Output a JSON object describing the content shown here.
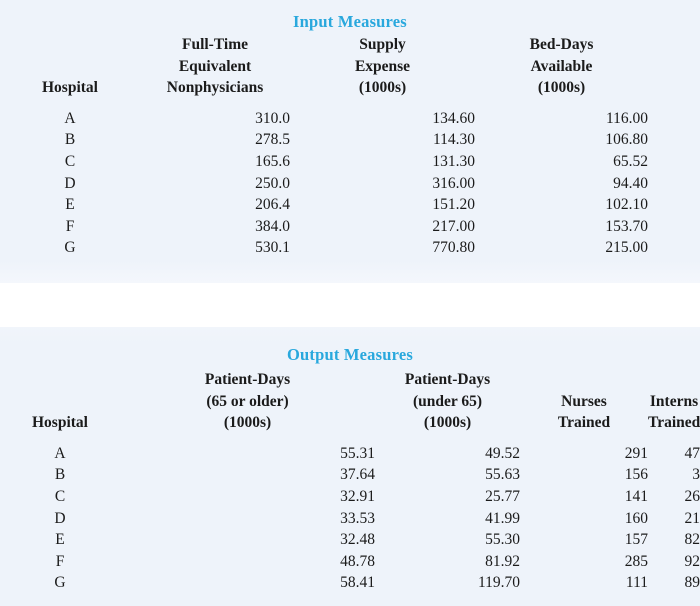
{
  "input_table": {
    "title": "Input Measures",
    "row_header_label": "Hospital",
    "columns": [
      {
        "lines": [
          "Full-Time",
          "Equivalent",
          "Nonphysicians"
        ]
      },
      {
        "lines": [
          "Supply",
          "Expense",
          "(1000s)"
        ]
      },
      {
        "lines": [
          "Bed-Days",
          "Available",
          "(1000s)"
        ]
      }
    ],
    "rows": [
      {
        "hospital": "A",
        "values": [
          "310.0",
          "134.60",
          "116.00"
        ]
      },
      {
        "hospital": "B",
        "values": [
          "278.5",
          "114.30",
          "106.80"
        ]
      },
      {
        "hospital": "C",
        "values": [
          "165.6",
          "131.30",
          "65.52"
        ]
      },
      {
        "hospital": "D",
        "values": [
          "250.0",
          "316.00",
          "94.40"
        ]
      },
      {
        "hospital": "E",
        "values": [
          "206.4",
          "151.20",
          "102.10"
        ]
      },
      {
        "hospital": "F",
        "values": [
          "384.0",
          "217.00",
          "153.70"
        ]
      },
      {
        "hospital": "G",
        "values": [
          "530.1",
          "770.80",
          "215.00"
        ]
      }
    ]
  },
  "output_table": {
    "title": "Output Measures",
    "row_header_label": "Hospital",
    "columns": [
      {
        "lines": [
          "Patient-Days",
          "(65 or older)",
          "(1000s)"
        ]
      },
      {
        "lines": [
          "Patient-Days",
          "(under 65)",
          "(1000s)"
        ]
      },
      {
        "lines": [
          "",
          "Nurses",
          "Trained"
        ]
      },
      {
        "lines": [
          "",
          "Interns",
          "Trained"
        ]
      }
    ],
    "rows": [
      {
        "hospital": "A",
        "values": [
          "55.31",
          "49.52",
          "291",
          "47"
        ]
      },
      {
        "hospital": "B",
        "values": [
          "37.64",
          "55.63",
          "156",
          "3"
        ]
      },
      {
        "hospital": "C",
        "values": [
          "32.91",
          "25.77",
          "141",
          "26"
        ]
      },
      {
        "hospital": "D",
        "values": [
          "33.53",
          "41.99",
          "160",
          "21"
        ]
      },
      {
        "hospital": "E",
        "values": [
          "32.48",
          "55.30",
          "157",
          "82"
        ]
      },
      {
        "hospital": "F",
        "values": [
          "48.78",
          "81.92",
          "285",
          "92"
        ]
      },
      {
        "hospital": "G",
        "values": [
          "58.41",
          "119.70",
          "111",
          "89"
        ]
      }
    ]
  },
  "colors": {
    "accent": "#29a8dd",
    "panel_background": "#eef3fa",
    "page_background": "#ffffff",
    "text": "#1b1b1b"
  }
}
